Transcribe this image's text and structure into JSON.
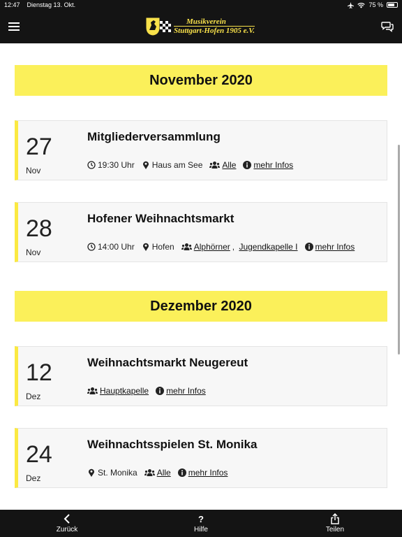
{
  "status": {
    "time": "12:47",
    "date": "Dienstag 13. Okt.",
    "battery": "75 %",
    "battery_level": 0.75
  },
  "header": {
    "logo_line1": "Musikverein",
    "logo_line2": "Stuttgart-Hofen 1905 e.V."
  },
  "months": [
    {
      "label": "November 2020"
    },
    {
      "label": "Dezember 2020"
    }
  ],
  "events": [
    {
      "day": "27",
      "month": "Nov",
      "title": "Mitgliederversammlung",
      "time": "19:30 Uhr",
      "place": "Haus am See",
      "groups": [
        "Alle"
      ],
      "more": "mehr Infos"
    },
    {
      "day": "28",
      "month": "Nov",
      "title": "Hofener Weihnachtsmarkt",
      "time": "14:00 Uhr",
      "place": "Hofen",
      "groups": [
        "Alphörner",
        "Jugendkapelle I"
      ],
      "more": "mehr Infos"
    },
    {
      "day": "12",
      "month": "Dez",
      "title": "Weihnachtsmarkt Neugereut",
      "groups": [
        "Hauptkapelle"
      ],
      "more": "mehr Infos"
    },
    {
      "day": "24",
      "month": "Dez",
      "title": "Weihnachtsspielen St. Monika",
      "place": "St. Monika",
      "groups": [
        "Alle"
      ],
      "more": "mehr Infos"
    }
  ],
  "bottom": {
    "back": "Zurück",
    "help_symbol": "?",
    "help": "Hilfe",
    "share": "Teilen"
  },
  "colors": {
    "accent": "#fbf05a",
    "bar": "#141414"
  }
}
